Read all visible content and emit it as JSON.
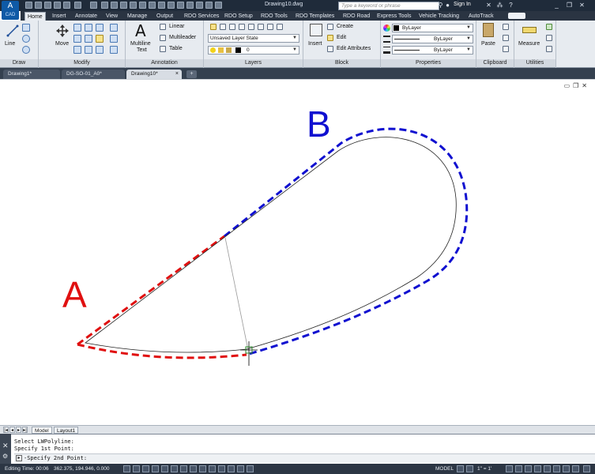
{
  "app": {
    "logo": "A",
    "logo_sub": "CAD"
  },
  "title": {
    "document": "Drawing10.dwg",
    "search_placeholder": "Type a keyword or phrase",
    "signin": "Sign In"
  },
  "ribbon_tabs": [
    "Home",
    "Insert",
    "Annotate",
    "View",
    "Manage",
    "Output",
    "RDO Services",
    "RDO Setup",
    "RDO Tools",
    "RDO Templates",
    "RDO Road",
    "Express Tools",
    "Vehicle Tracking",
    "AutoTrack"
  ],
  "active_tab": "Home",
  "panels": {
    "draw": {
      "label": "Draw",
      "line": "Line"
    },
    "modify": {
      "label": "Modify",
      "move": "Move"
    },
    "annotation": {
      "label": "Annotation",
      "multiline_text_1": "Multiline",
      "multiline_text_2": "Text",
      "linear": "Linear",
      "multileader": "Multileader",
      "table": "Table"
    },
    "layers": {
      "label": "Layers",
      "layer_state": "Unsaved Layer State",
      "current_layer": "0"
    },
    "block": {
      "label": "Block",
      "insert": "Insert",
      "create": "Create",
      "edit": "Edit",
      "edit_attributes": "Edit Attributes"
    },
    "properties": {
      "label": "Properties",
      "color": "ByLayer",
      "linetype": "ByLayer",
      "lineweight": "ByLayer"
    },
    "clipboard": {
      "label": "Clipboard",
      "paste": "Paste"
    },
    "utilities": {
      "label": "Utilities",
      "measure": "Measure"
    }
  },
  "doc_tabs": [
    {
      "label": "Drawing1*",
      "active": false
    },
    {
      "label": "DG-SO-01_A0*",
      "active": false
    },
    {
      "label": "Drawing10*",
      "active": true
    }
  ],
  "drawing": {
    "label_a": "A",
    "label_b": "B",
    "color_a": "#e01010",
    "color_b": "#1010d0"
  },
  "layout_tabs": [
    "Model",
    "Layout1"
  ],
  "command": {
    "line1": "Select LWPolyline:",
    "line2": "Specify 1st Point:",
    "prompt": "-Specify 2nd Point:"
  },
  "status": {
    "editing_time": "Editing Time: 00:06",
    "coords": "362.375, 194.946, 0.000",
    "model": "MODEL",
    "scale": "1\" = 1'"
  }
}
